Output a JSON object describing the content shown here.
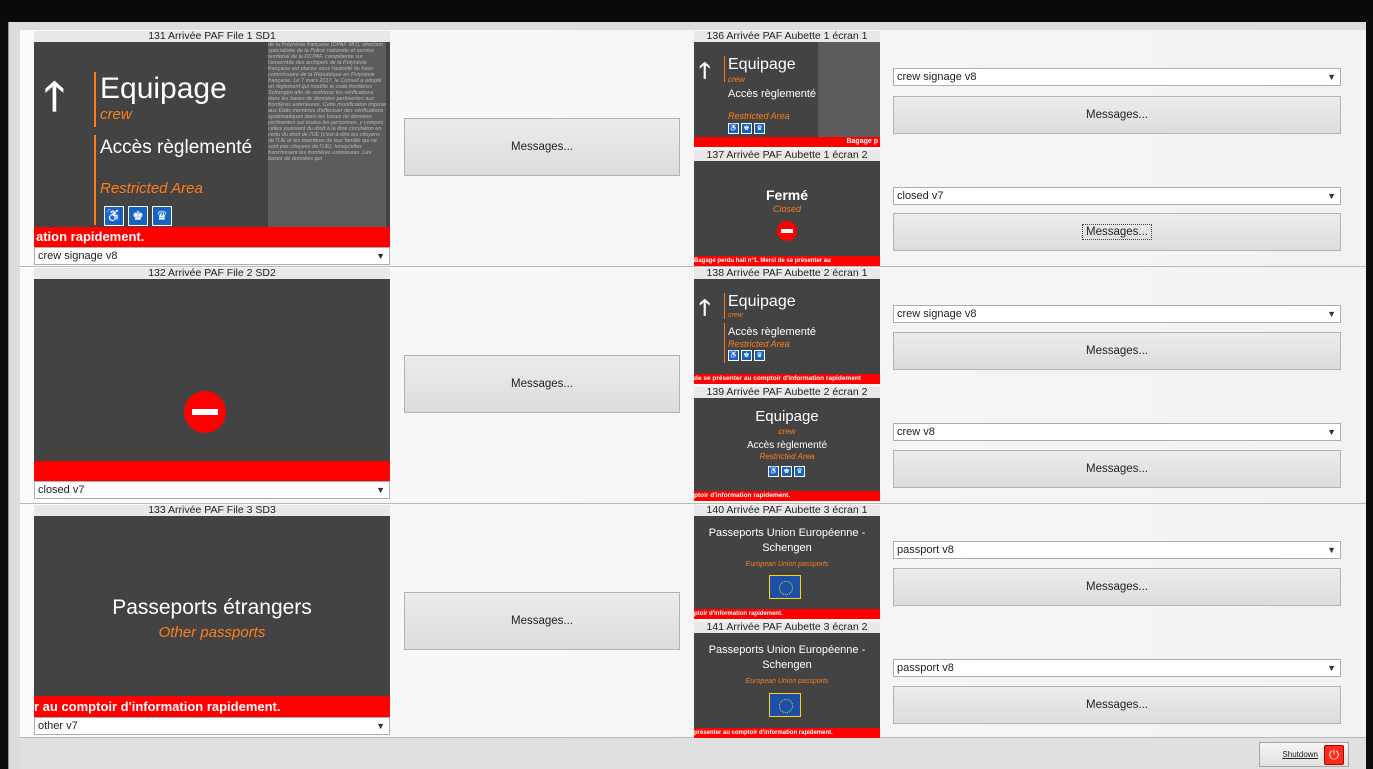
{
  "panels": [
    {
      "title": "131 Arrivée PAF File 1 SD1",
      "heading": "Equipage",
      "heading_sub": "crew",
      "access": "Accès règlementé",
      "access_sub": "Restricted Area",
      "ticker": "ation rapidement.",
      "fine_text": "de la Polynésie française (DPAF 987), direction spécialisée de la Police nationale et service territorial de la DCPAF, compétente sur l'ensemble des archipels de la Polynésie française est placée sous l'autorité du haut-commissaire de la République en Polynésie française. Le 7 mars 2017, le Conseil a adopté un règlement qui modifie le code frontières Schengen afin de renforcer les vérifications dans les bases de données pertinentes aux frontières extérieures. Cette modification impose aux États membres d'effectuer des vérifications systématiques dans les bases de données pertinentes sur toutes les personnes, y compris celles jouissant du droit à la libre circulation en vertu du droit de l'UE (c'est-à-dire les citoyens de l'UE et les membres de leur famille qui ne sont pas citoyens de l'UE), lorsqu'elles franchissent les frontières extérieures. Les bases de données qui",
      "select": "crew signage v8",
      "button": "Messages..."
    },
    {
      "title": "132 Arrivée PAF File 2 SD2",
      "select": "closed v7",
      "button": "Messages..."
    },
    {
      "title": "133 Arrivée PAF File 3 SD3",
      "heading": "Passeports étrangers",
      "heading_sub": "Other passports",
      "ticker": "r au comptoir d'information rapidement.",
      "select": "other v7",
      "button": "Messages..."
    }
  ],
  "booths": [
    {
      "title": "136 Arrivée PAF Aubette 1 écran 1",
      "heading": "Equipage",
      "heading_sub": "crew",
      "access": "Accès règlementé",
      "access_sub": "Restricted Area",
      "ticker": "Bagage p",
      "select": "crew signage v8",
      "button": "Messages..."
    },
    {
      "title": "137 Arrivée PAF Aubette 1 écran 2",
      "heading": "Fermé",
      "heading_sub": "Closed",
      "ticker": "Bagage perdu hall n°1. Merci de se présenter au",
      "select": "closed v7",
      "button": "Messages..."
    },
    {
      "title": "138 Arrivée PAF Aubette 2 écran 1",
      "heading": "Equipage",
      "heading_sub": "crew",
      "access": "Accès règlementé",
      "access_sub": "Restricted Area",
      "ticker": "de se présenter au comptoir d'information rapidement",
      "select": "crew signage v8",
      "button": "Messages..."
    },
    {
      "title": "139 Arrivée PAF Aubette 2 écran 2",
      "heading": "Equipage",
      "heading_sub": "crew",
      "access": "Accès règlementé",
      "access_sub": "Restricted Area",
      "ticker": "ptoir d'information rapidement.",
      "select": "crew v8",
      "button": "Messages..."
    },
    {
      "title": "140 Arrivée PAF Aubette 3 écran 1",
      "heading": "Passeports Union Européenne - Schengen",
      "heading_sub": "European Union passports",
      "ticker": "ptoir d'information rapidement.",
      "select": "passport v8",
      "button": "Messages..."
    },
    {
      "title": "141 Arrivée PAF Aubette 3 écran 2",
      "heading": "Passeports Union Européenne - Schengen",
      "heading_sub": "European Union passports",
      "ticker": "présenter au comptoir d'information rapidement.",
      "select": "passport v8",
      "button": "Messages..."
    }
  ],
  "icons": {
    "wheelchair": "♿",
    "family": "♚",
    "pregnant": "♛",
    "arrow": "🡑"
  },
  "shutdown": {
    "label": "Shutdown",
    "icon": "⏻"
  }
}
